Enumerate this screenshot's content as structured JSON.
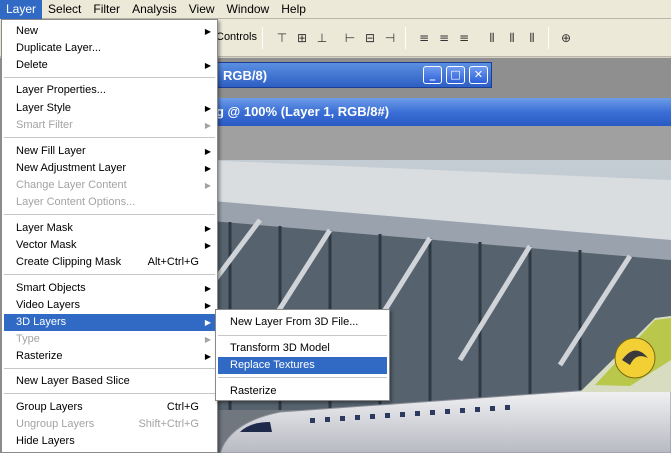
{
  "menubar": {
    "items": [
      "Layer",
      "Select",
      "Filter",
      "Analysis",
      "View",
      "Window",
      "Help"
    ],
    "active": "Layer"
  },
  "options_bar": {
    "controls_label": "Controls"
  },
  "windows": {
    "back_title": "RGB/8)",
    "front_title": "g @ 100% (Layer 1, RGB/8#)"
  },
  "layer_menu": {
    "items": [
      {
        "label": "New",
        "submenu": true
      },
      {
        "label": "Duplicate Layer..."
      },
      {
        "label": "Delete",
        "submenu": true
      },
      {
        "label": "Layer Properties..."
      },
      {
        "label": "Layer Style",
        "submenu": true
      },
      {
        "label": "Smart Filter",
        "submenu": true,
        "disabled": true
      },
      {
        "label": "New Fill Layer",
        "submenu": true
      },
      {
        "label": "New Adjustment Layer",
        "submenu": true
      },
      {
        "label": "Change Layer Content",
        "submenu": true,
        "disabled": true
      },
      {
        "label": "Layer Content Options...",
        "disabled": true
      },
      {
        "label": "Layer Mask",
        "submenu": true
      },
      {
        "label": "Vector Mask",
        "submenu": true
      },
      {
        "label": "Create Clipping Mask",
        "shortcut": "Alt+Ctrl+G"
      },
      {
        "label": "Smart Objects",
        "submenu": true
      },
      {
        "label": "Video Layers",
        "submenu": true
      },
      {
        "label": "3D Layers",
        "submenu": true,
        "highlighted": true
      },
      {
        "label": "Type",
        "submenu": true,
        "disabled": true
      },
      {
        "label": "Rasterize",
        "submenu": true
      },
      {
        "label": "New Layer Based Slice"
      },
      {
        "label": "Group Layers",
        "shortcut": "Ctrl+G"
      },
      {
        "label": "Ungroup Layers",
        "shortcut": "Shift+Ctrl+G",
        "disabled": true
      },
      {
        "label": "Hide Layers"
      }
    ]
  },
  "submenu_3d": {
    "items": [
      {
        "label": "New Layer From 3D File..."
      },
      {
        "label": "Transform 3D Model"
      },
      {
        "label": "Replace Textures",
        "highlighted": true
      },
      {
        "label": "Rasterize"
      }
    ]
  },
  "colors": {
    "highlight": "#316ac5",
    "menubar_bg": "#ece9d8",
    "title_blue": "#2a5ac4",
    "disabled_text": "#a3a3a3"
  }
}
